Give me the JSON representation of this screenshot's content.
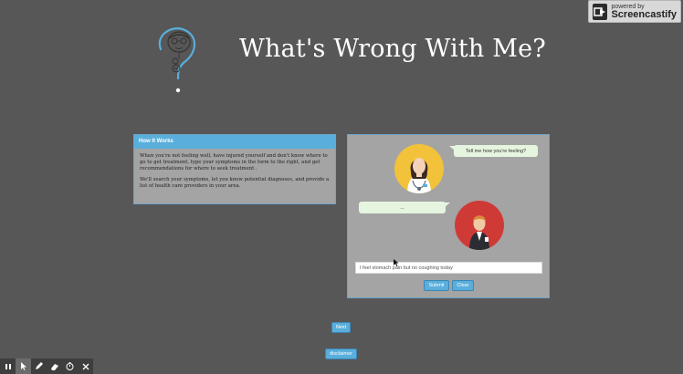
{
  "badge": {
    "small_text": "powered by",
    "brand_text": "Screencastify",
    "icon": "screencastify-logo-icon"
  },
  "header": {
    "title": "What's Wrong With Me?",
    "logo_icon": "question-mark-face-logo"
  },
  "how_it_works": {
    "title": "How It Works",
    "paragraph_1": "When you're not feeling well, have injured yourself and don't know where to go to get treatment, type your symptoms in the form to the right, and get recommendations for where to seek treatment .",
    "paragraph_2": "We'll search your symptoms, let you know potential diagnoses, and provide a list of health care providers in your area."
  },
  "chat": {
    "doctor_message": "Tell me how you're feeling?",
    "user_message": "...",
    "input_value": "I feel stomach pain but no coughing today",
    "submit_label": "Submit",
    "clear_label": "Clear"
  },
  "navigation": {
    "next_label": "Next",
    "disclaimer_label": "disclaimer"
  },
  "toolbar": {
    "tools": [
      "pause-icon",
      "pointer-icon",
      "pen-icon",
      "eraser-icon",
      "timer-icon",
      "close-icon"
    ],
    "active_tool": "pointer-icon"
  },
  "colors": {
    "background": "#575757",
    "accent_blue": "#5aaedb",
    "panel_gray": "#a4a4a4",
    "bubble_green": "#e6f5df",
    "doctor_yellow": "#f2c23a",
    "user_red": "#cf3a36"
  }
}
